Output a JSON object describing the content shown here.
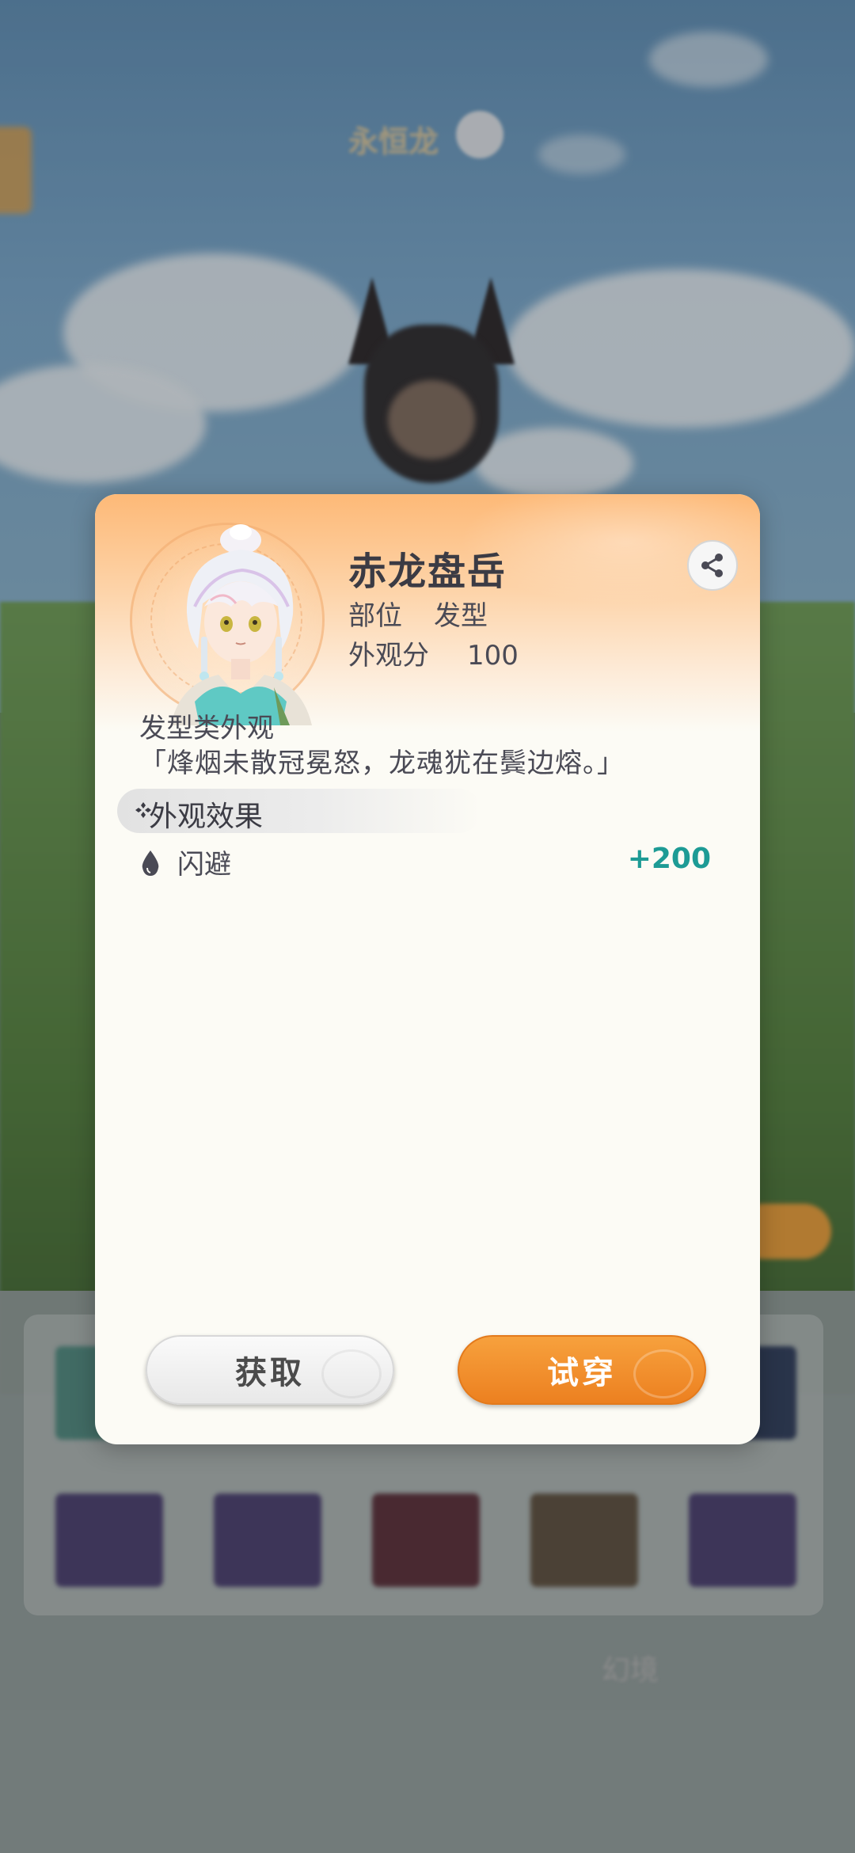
{
  "background": {
    "top_label": "永恒龙",
    "top_badge": "",
    "bottom_text": "幻境"
  },
  "dialog": {
    "item_name": "赤龙盘岳",
    "part_label": "部位",
    "part_value": "发型",
    "score_label": "外观分",
    "score_value": "100",
    "type_text": "发型类外观",
    "quote": "「烽烟未散冠冕怒，龙魂犹在鬓边熔。」",
    "section_title": "外观效果",
    "stat": {
      "name": "闪避",
      "value": "+200",
      "icon": "water-drop-icon"
    },
    "get_button": "获取",
    "try_button": "试穿",
    "share_icon": "share-icon",
    "colors": {
      "accent_orange": "#ec8020",
      "stat_teal": "#1d9b95",
      "header_orange": "#fdb977"
    }
  }
}
